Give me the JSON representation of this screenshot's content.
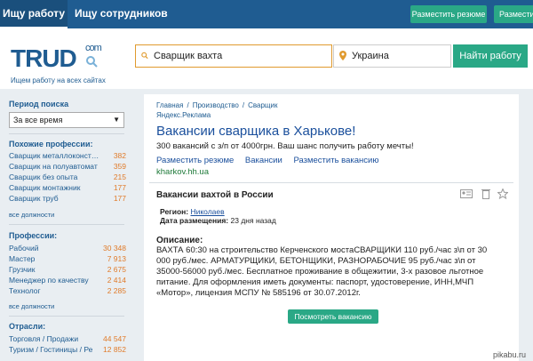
{
  "topnav": {
    "tab_jobs": "Ищу работу",
    "tab_staff": "Ищу сотрудников",
    "post_resume": "Разместить резюме",
    "post_vacancy": "Размести"
  },
  "header": {
    "logo": "TRUD",
    "logo_suffix": "com",
    "tagline": "Ищем работу на всех сайтах",
    "search_value": "Сварщик вахта",
    "region_value": "Украина",
    "find_button": "Найти работу"
  },
  "sidebar": {
    "period_title": "Период поиска",
    "period_value": "За все время",
    "similar_title": "Похожие профессии:",
    "similar": [
      {
        "label": "Сварщик металлоконст…",
        "count": "382"
      },
      {
        "label": "Сварщик на полуавтомат",
        "count": "359"
      },
      {
        "label": "Сварщик без опыта",
        "count": "215"
      },
      {
        "label": "Сварщик монтажник",
        "count": "177"
      },
      {
        "label": "Сварщик труб",
        "count": "177"
      }
    ],
    "all_positions": "все должности",
    "professions_title": "Профессии:",
    "professions": [
      {
        "label": "Рабочий",
        "count": "30 348"
      },
      {
        "label": "Мастер",
        "count": "7 913"
      },
      {
        "label": "Грузчик",
        "count": "2 675"
      },
      {
        "label": "Менеджер по качеству",
        "count": "2 414"
      },
      {
        "label": "Технолог",
        "count": "2 285"
      }
    ],
    "all_positions_2": "все должности",
    "industries_title": "Отрасли:",
    "industries": [
      {
        "label": "Торговля / Продажи",
        "count": "44 547"
      },
      {
        "label": "Туризм / Гостиницы / Ре",
        "count": "12 852"
      }
    ]
  },
  "main": {
    "breadcrumbs": [
      "Главная",
      "/",
      "Производство",
      "/",
      "Сварщик"
    ],
    "yandex": "Яндекс.Реклама",
    "ad_title": "Вакансии сварщика в Харькове!",
    "ad_text": "300 вакансий с з/п от 4000грн. Ваш шанс получить работу мечты!",
    "ad_links": [
      "Разместить резюме",
      "Вакансии",
      "Разместить вакансию"
    ],
    "ad_url": "kharkov.hh.ua",
    "vacancy_title": "Вакансии вахтой в России",
    "region_label": "Регион:",
    "region_value": "Николаев",
    "date_label": "Дата размещения:",
    "date_value": "23 дня назад",
    "desc_title": "Описание:",
    "desc_lines": [
      "ВАХТА 60:30 на строительство Керченского мостаСВАРЩИКИ 110 руб./час з\\п от 30",
      "000 руб./мес. АРМАТУРЩИКИ, БЕТОНЩИКИ, РАЗНОРАБОЧИЕ 95 руб./час з\\п от",
      "35000-56000 руб./мес. Бесплатное проживание в общежитии, 3-х разовое льготное",
      "питание. Для оформления иметь документы: паспорт, удостоверение, ИНН,МЧП",
      "«Мотор», лицензия МСПУ № 585196 от 30.07.2012г."
    ],
    "view_button": "Посмотреть вакансию"
  },
  "watermark": "pikabu.ru",
  "colors": {
    "brand_blue": "#1f5c91",
    "accent_green": "#2aa886",
    "count_orange": "#e07b2a"
  }
}
